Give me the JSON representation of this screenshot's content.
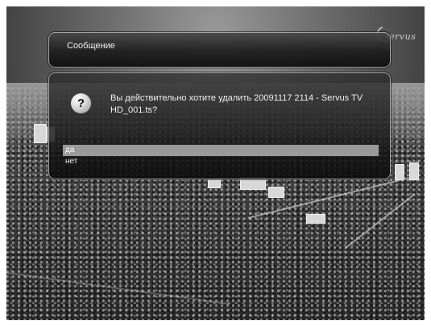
{
  "dialog": {
    "title": "Сообщение",
    "message": "Вы действительно хотите удалить 20091117 2114 - Servus TV HD_001.ts?",
    "options": [
      {
        "label": "да",
        "selected": true
      },
      {
        "label": "нет",
        "selected": false
      }
    ]
  },
  "icons": {
    "question": "question-mark-icon",
    "channel_logo": "servus-logo-icon"
  },
  "colors": {
    "panel": "#1e1e1e",
    "selection": "#9a9a9a",
    "text": "#f0f0f0"
  }
}
